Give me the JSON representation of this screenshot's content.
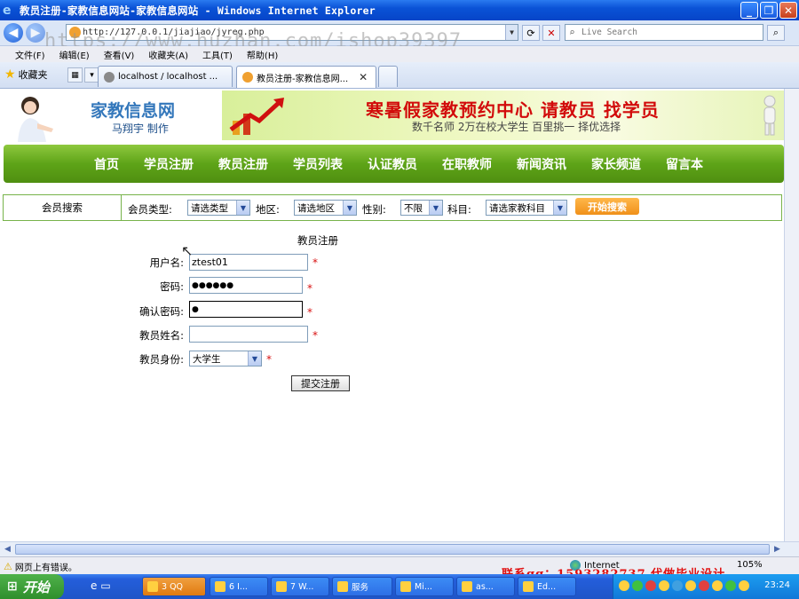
{
  "window": {
    "title": "教员注册-家教信息网站-家教信息网站 - Windows Internet Explorer",
    "url": "http://127.0.0.1/jiajiao/jyreg.php",
    "search_placeholder": "Live Search",
    "watermark": "https://www.huzhan.com/ishop39397"
  },
  "menu": [
    "文件(F)",
    "编辑(E)",
    "查看(V)",
    "收藏夹(A)",
    "工具(T)",
    "帮助(H)"
  ],
  "favorites_label": "收藏夹",
  "tabs": [
    {
      "label": "localhost / localhost ...",
      "active": false
    },
    {
      "label": "教员注册-家教信息网...",
      "active": true
    }
  ],
  "site": {
    "logo_name": "家教信息网",
    "logo_author": "马翔宇 制作",
    "banner_slogan": "寒暑假家教预约中心 请教员 找学员",
    "banner_sub": "数千名师 2万在校大学生 百里挑一 择优选择",
    "nav": [
      "首页",
      "学员注册",
      "教员注册",
      "学员列表",
      "认证教员",
      "在职教师",
      "新闻资讯",
      "家长频道",
      "留言本"
    ]
  },
  "search_bar": {
    "label": "会员搜索",
    "type_label": "会员类型:",
    "type_value": "请选类型",
    "area_label": "地区:",
    "area_value": "请选地区",
    "gender_label": "性别:",
    "gender_value": "不限",
    "subject_label": "科目:",
    "subject_value": "请选家教科目",
    "button": "开始搜索"
  },
  "form": {
    "title": "教员注册",
    "username_label": "用户名:",
    "username_value": "ztest01",
    "password_label": "密码:",
    "password_value": "●●●●●●",
    "confirm_label": "确认密码:",
    "confirm_value": "●",
    "realname_label": "教员姓名:",
    "realname_value": "",
    "identity_label": "教员身份:",
    "identity_value": "大学生",
    "required_mark": "*",
    "submit": "提交注册"
  },
  "status": {
    "error_text": "网页上有错误。",
    "zone": "Internet",
    "zoom": "105%"
  },
  "contact_overlay": "联系qq：1593282737 代做毕业设计",
  "taskbar": {
    "start": "开始",
    "tasks": [
      "3 QQ",
      "6 I...",
      "7 W...",
      "服务",
      "Mi...",
      "as...",
      "Ed..."
    ],
    "clock": "23:24"
  },
  "colors": {
    "nav_green": "#5ea418",
    "slogan_red": "#d20b0b",
    "title_blue": "#0a52d6"
  }
}
